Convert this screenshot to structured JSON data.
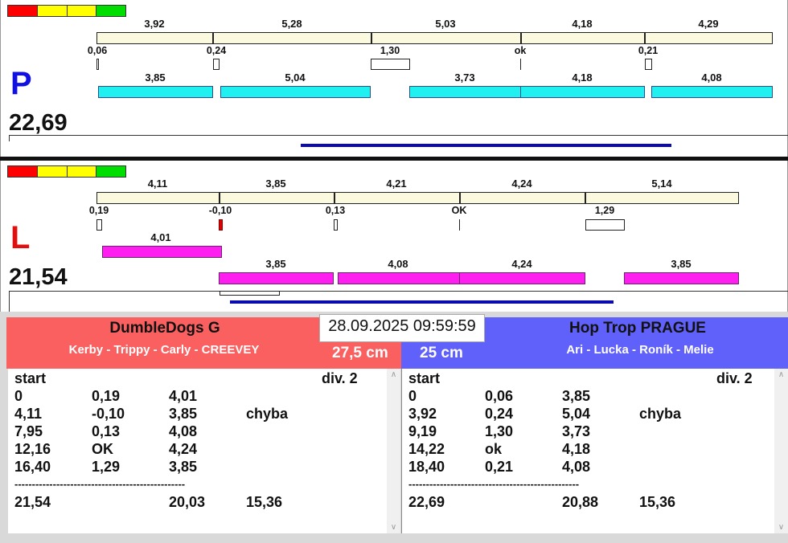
{
  "panel_p": {
    "letter": "P",
    "letter_color": "#1010e0",
    "total": "22,69",
    "segment_labels": [
      "3,92",
      "5,28",
      "5,03",
      "4,18",
      "4,29"
    ],
    "gap_labels": [
      "0,06",
      "0,24",
      "1,30",
      "ok",
      "0,21"
    ],
    "run_labels": [
      "3,85",
      "5,04",
      "3,73",
      "4,18",
      "4,08"
    ]
  },
  "panel_l": {
    "letter": "L",
    "letter_color": "#e01010",
    "total": "21,54",
    "segment_labels": [
      "4,11",
      "3,85",
      "4,21",
      "4,24",
      "5,14"
    ],
    "gap_labels": [
      "0,19",
      "-0,10",
      "0,13",
      "OK",
      "1,29"
    ],
    "upper_run_label": "4,01",
    "run_labels": [
      "3,85",
      "4,08",
      "4,24",
      "3,85"
    ]
  },
  "status_lights": [
    "#ff0000",
    "#ffff00",
    "#ffff00",
    "#00dd00"
  ],
  "accent": {
    "fault_red": "#e00000",
    "progress_blue": "#0a0ab0"
  },
  "datetime": "28.09.2025 09:59:59",
  "team_red": {
    "name": "DumbleDogs G",
    "members": "Kerby - Trippy - Carly - CREEVEY",
    "height": "27,5 cm",
    "color": "#fa6060"
  },
  "team_blue": {
    "name": "Hop Trop PRAGUE",
    "members": "Ari - Lucka - Roník - Melie",
    "height": "25 cm",
    "color": "#6060fa"
  },
  "result_red": {
    "start": "start",
    "division": "div.  2",
    "rows": [
      [
        "0",
        "0,19",
        "4,01",
        ""
      ],
      [
        "4,11",
        "-0,10",
        "3,85",
        "chyba"
      ],
      [
        "7,95",
        "0,13",
        "4,08",
        ""
      ],
      [
        "12,16",
        "OK",
        "4,24",
        ""
      ],
      [
        "16,40",
        "1,29",
        "3,85",
        ""
      ]
    ],
    "separator": "-------------------------------------------------",
    "totals": [
      "21,54",
      "",
      "20,03",
      "15,36"
    ]
  },
  "result_blue": {
    "start": "start",
    "division": "div.  2",
    "rows": [
      [
        "0",
        "0,06",
        "3,85",
        ""
      ],
      [
        "3,92",
        "0,24",
        "5,04",
        "chyba"
      ],
      [
        "9,19",
        "1,30",
        "3,73",
        ""
      ],
      [
        "14,22",
        "ok",
        "4,18",
        ""
      ],
      [
        "18,40",
        "0,21",
        "4,08",
        ""
      ]
    ],
    "separator": "-------------------------------------------------",
    "totals": [
      "22,69",
      "",
      "20,88",
      "15,36"
    ]
  }
}
